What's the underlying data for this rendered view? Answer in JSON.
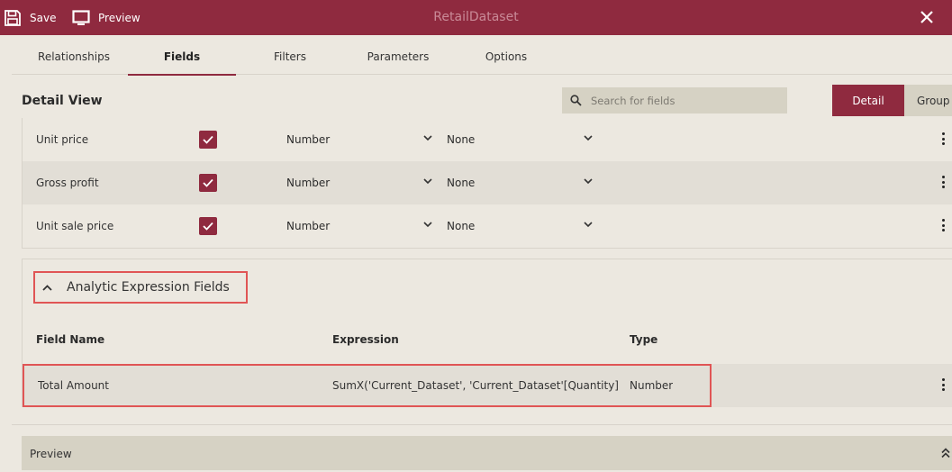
{
  "header": {
    "title": "RetailDataset",
    "save_label": "Save",
    "preview_label": "Preview",
    "save_icon": "save-icon",
    "preview_icon": "monitor-icon",
    "close_icon": "close-icon"
  },
  "tabs": [
    {
      "label": "Relationships",
      "active": false
    },
    {
      "label": "Fields",
      "active": true
    },
    {
      "label": "Filters",
      "active": false
    },
    {
      "label": "Parameters",
      "active": false
    },
    {
      "label": "Options",
      "active": false
    }
  ],
  "view": {
    "title": "Detail View",
    "search_placeholder": "Search for fields",
    "search_value": "",
    "detail_label": "Detail",
    "group_label": "Group"
  },
  "fields": [
    {
      "name": "Unit price",
      "checked": true,
      "type": "Number",
      "aggregation": "None"
    },
    {
      "name": "Gross profit",
      "checked": true,
      "type": "Number",
      "aggregation": "None"
    },
    {
      "name": "Unit sale price",
      "checked": true,
      "type": "Number",
      "aggregation": "None"
    }
  ],
  "analytic": {
    "title": "Analytic Expression Fields",
    "expanded": true,
    "columns": {
      "field_name": "Field Name",
      "expression": "Expression",
      "type": "Type"
    },
    "rows": [
      {
        "field_name": "Total Amount",
        "expression": "SumX('Current_Dataset', 'Current_Dataset'[Quantity] *'Curr...",
        "type": "Number"
      }
    ]
  },
  "preview": {
    "label": "Preview"
  },
  "colors": {
    "brand": "#8f2a3f",
    "highlight": "#e05555",
    "background": "#ece8e0",
    "panel": "#d6d2c4"
  }
}
